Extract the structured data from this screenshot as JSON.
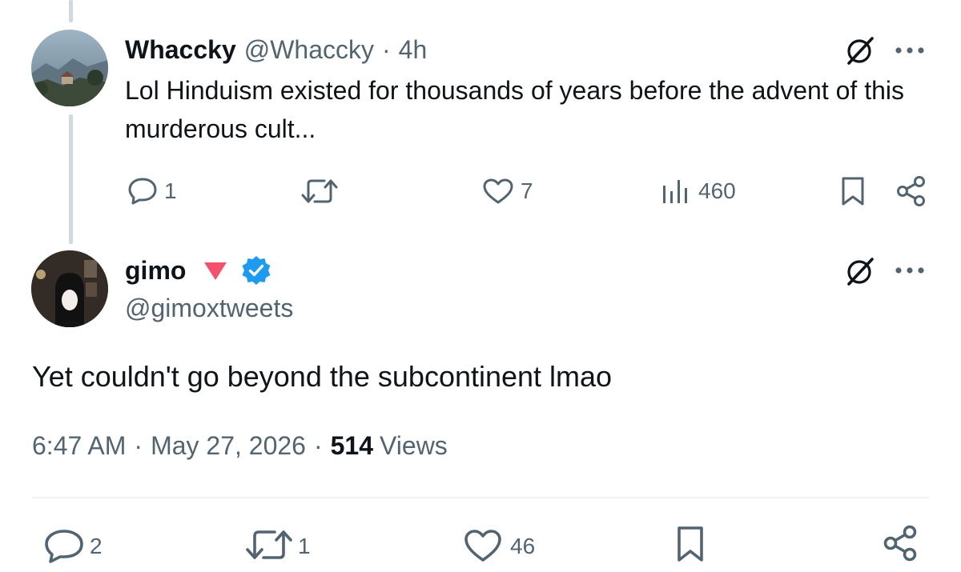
{
  "parent_tweet": {
    "display_name": "Whaccky",
    "handle": "@Whaccky",
    "separator": "·",
    "time_ago": "4h",
    "text": "Lol Hinduism existed for thousands of years before the advent of this murderous cult...",
    "actions": {
      "replies": "1",
      "retweets": "",
      "likes": "7",
      "views": "460"
    }
  },
  "main_tweet": {
    "display_name": "gimo",
    "handle": "@gimoxtweets",
    "text": "Yet couldn't go beyond the subcontinent lmao",
    "time": "6:47 AM",
    "separator": "·",
    "date": "May 27, 2026",
    "views_count": "514",
    "views_label": "Views",
    "actions": {
      "replies": "2",
      "retweets": "1",
      "likes": "46"
    }
  },
  "colors": {
    "text_primary": "#0f1419",
    "text_secondary": "#536471",
    "verified_blue": "#1d9bf0",
    "flag_pink": "#f4516c",
    "thread_line": "#cfd9de"
  },
  "icons": [
    "grok-icon",
    "more-icon",
    "reply-icon",
    "retweet-icon",
    "like-icon",
    "views-icon",
    "bookmark-icon",
    "share-icon",
    "verified-badge-icon",
    "red-triangle-emoji"
  ]
}
